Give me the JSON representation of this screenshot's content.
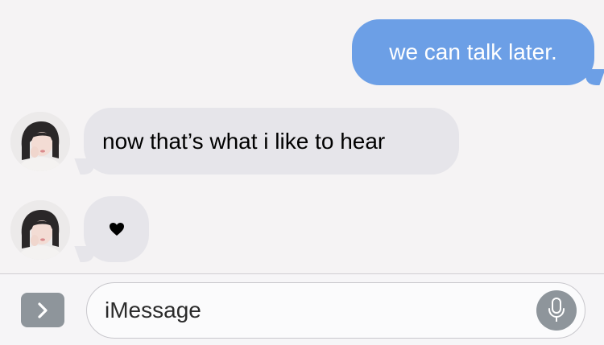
{
  "messages": [
    {
      "direction": "outgoing",
      "text": "we can talk later."
    },
    {
      "direction": "incoming",
      "text": "now that’s what i like to hear"
    },
    {
      "direction": "incoming",
      "emoji": "heart-icon"
    }
  ],
  "input": {
    "placeholder": "iMessage",
    "apps_icon": "chevron-right-icon",
    "mic_icon": "microphone-icon"
  },
  "colors": {
    "outgoing_bubble": "#6c9fe6",
    "incoming_bubble": "#e6e5ea",
    "background": "#f5f3f4",
    "button_grey": "#8e959b"
  }
}
